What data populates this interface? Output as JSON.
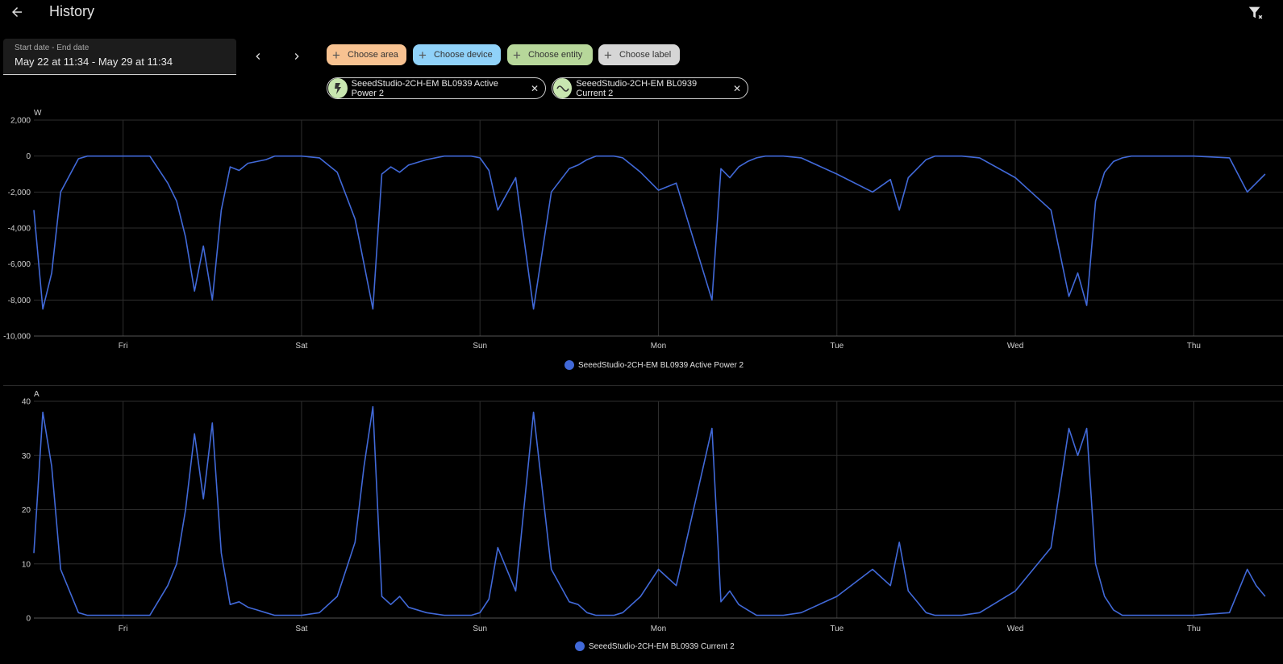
{
  "header": {
    "title": "History",
    "back_icon": "arrow-left-icon",
    "filter_icon": "filter-remove-icon"
  },
  "date_range": {
    "label": "Start date - End date",
    "value": "May 22 at 11:34 - May 29 at 11:34"
  },
  "filters": {
    "chips": [
      {
        "label": "Choose area",
        "color": "#f8c291"
      },
      {
        "label": "Choose device",
        "color": "#90d2f9"
      },
      {
        "label": "Choose entity",
        "color": "#b7d79a"
      },
      {
        "label": "Choose label",
        "color": "#d6d6d6"
      }
    ],
    "selected": [
      {
        "label": "SeeedStudio-2CH-EM BL0939 Active Power 2",
        "icon": "flash-icon"
      },
      {
        "label": "SeeedStudio-2CH-EM BL0939 Current 2",
        "icon": "current-ac-icon"
      }
    ]
  },
  "charts": [
    {
      "unit": "W",
      "y_ticks": [
        "2,000",
        "0",
        "-2,000",
        "-4,000",
        "-6,000",
        "-8,000",
        "-10,000"
      ],
      "x_ticks": [
        "Fri",
        "Sat",
        "Sun",
        "Mon",
        "Tue",
        "Wed",
        "Thu"
      ],
      "legend": "SeeedStudio-2CH-EM BL0939 Active Power 2"
    },
    {
      "unit": "A",
      "y_ticks": [
        "40",
        "30",
        "20",
        "10",
        "0"
      ],
      "x_ticks": [
        "Fri",
        "Sat",
        "Sun",
        "Mon",
        "Tue",
        "Wed",
        "Thu"
      ],
      "legend": "SeeedStudio-2CH-EM BL0939 Current 2"
    }
  ],
  "chart_data": [
    {
      "type": "line",
      "title": "",
      "ylabel": "W",
      "ylim": [
        -10000,
        2000
      ],
      "x_range": [
        "May 22 11:34",
        "May 29 11:34"
      ],
      "categories": [
        "Fri",
        "Sat",
        "Sun",
        "Mon",
        "Tue",
        "Wed",
        "Thu"
      ],
      "series": [
        {
          "name": "SeeedStudio-2CH-EM BL0939 Active Power 2",
          "color": "#4169d8",
          "x": [
            0.0,
            0.05,
            0.1,
            0.15,
            0.25,
            0.3,
            0.35,
            0.45,
            0.65,
            0.75,
            0.8,
            0.85,
            0.9,
            0.95,
            1.0,
            1.05,
            1.1,
            1.15,
            1.2,
            1.25,
            1.3,
            1.35,
            1.4,
            1.5,
            1.6,
            1.7,
            1.75,
            1.8,
            1.85,
            1.9,
            1.95,
            2.0,
            2.05,
            2.1,
            2.2,
            2.3,
            2.4,
            2.45,
            2.5,
            2.55,
            2.6,
            2.7,
            2.8,
            2.9,
            3.0,
            3.05,
            3.1,
            3.15,
            3.2,
            3.25,
            3.3,
            3.4,
            3.5,
            3.6,
            3.8,
            3.85,
            3.9,
            3.95,
            4.0,
            4.05,
            4.1,
            4.15,
            4.2,
            4.3,
            4.5,
            4.7,
            4.8,
            4.85,
            4.9,
            4.95,
            5.0,
            5.05,
            5.1,
            5.15,
            5.2,
            5.3,
            5.5,
            5.7,
            5.8,
            5.85,
            5.9,
            5.95,
            6.0,
            6.05,
            6.1,
            6.15,
            6.2,
            6.3,
            6.5,
            6.7,
            6.8,
            6.85,
            6.9
          ],
          "values": [
            -3000,
            -8500,
            -6500,
            -2000,
            -150,
            0,
            0,
            0,
            0,
            -1500,
            -2500,
            -4500,
            -7500,
            -5000,
            -8000,
            -3000,
            -600,
            -800,
            -400,
            -300,
            -200,
            0,
            0,
            0,
            -100,
            -900,
            -2200,
            -3500,
            -6000,
            -8500,
            -1000,
            -600,
            -900,
            -500,
            -200,
            0,
            0,
            0,
            -100,
            -800,
            -3000,
            -1200,
            -8500,
            -2000,
            -700,
            -500,
            -200,
            0,
            0,
            0,
            -100,
            -900,
            -1900,
            -1500,
            -8000,
            -700,
            -1200,
            -600,
            -300,
            -100,
            0,
            0,
            0,
            -100,
            -1000,
            -2000,
            -1300,
            -3000,
            -1200,
            -700,
            -200,
            0,
            0,
            0,
            0,
            -100,
            -1200,
            -3000,
            -7800,
            -6500,
            -8300,
            -2500,
            -900,
            -300,
            -100,
            0,
            0,
            0,
            0,
            -100,
            -2000,
            -1500,
            -1000
          ]
        }
      ]
    },
    {
      "type": "line",
      "title": "",
      "ylabel": "A",
      "ylim": [
        0,
        40
      ],
      "x_range": [
        "May 22 11:34",
        "May 29 11:34"
      ],
      "categories": [
        "Fri",
        "Sat",
        "Sun",
        "Mon",
        "Tue",
        "Wed",
        "Thu"
      ],
      "series": [
        {
          "name": "SeeedStudio-2CH-EM BL0939 Current 2",
          "color": "#4169d8",
          "x": [
            0.0,
            0.05,
            0.1,
            0.15,
            0.25,
            0.3,
            0.35,
            0.45,
            0.65,
            0.75,
            0.8,
            0.85,
            0.9,
            0.95,
            1.0,
            1.05,
            1.1,
            1.15,
            1.2,
            1.25,
            1.3,
            1.35,
            1.4,
            1.5,
            1.6,
            1.7,
            1.75,
            1.8,
            1.85,
            1.9,
            1.95,
            2.0,
            2.05,
            2.1,
            2.2,
            2.3,
            2.4,
            2.45,
            2.5,
            2.55,
            2.6,
            2.7,
            2.8,
            2.9,
            3.0,
            3.05,
            3.1,
            3.15,
            3.2,
            3.25,
            3.3,
            3.4,
            3.5,
            3.6,
            3.8,
            3.85,
            3.9,
            3.95,
            4.0,
            4.05,
            4.1,
            4.15,
            4.2,
            4.3,
            4.5,
            4.7,
            4.8,
            4.85,
            4.9,
            4.95,
            5.0,
            5.05,
            5.1,
            5.15,
            5.2,
            5.3,
            5.5,
            5.7,
            5.8,
            5.85,
            5.9,
            5.95,
            6.0,
            6.05,
            6.1,
            6.15,
            6.2,
            6.3,
            6.5,
            6.7,
            6.8,
            6.85,
            6.9
          ],
          "values": [
            12,
            38,
            28,
            9,
            1,
            0.5,
            0.5,
            0.5,
            0.5,
            6,
            10,
            20,
            34,
            22,
            36,
            12,
            2.5,
            3,
            2,
            1.5,
            1,
            0.5,
            0.5,
            0.5,
            1,
            4,
            9,
            14,
            28,
            39,
            4,
            2.5,
            4,
            2,
            1,
            0.5,
            0.5,
            0.5,
            1,
            3.5,
            13,
            5,
            38,
            9,
            3,
            2.5,
            1,
            0.5,
            0.5,
            0.5,
            1,
            4,
            9,
            6,
            35,
            3,
            5,
            2.5,
            1.5,
            0.5,
            0.5,
            0.5,
            0.5,
            1,
            4,
            9,
            6,
            14,
            5,
            3,
            1,
            0.5,
            0.5,
            0.5,
            0.5,
            1,
            5,
            13,
            35,
            30,
            35,
            10,
            4,
            1.5,
            0.5,
            0.5,
            0.5,
            0.5,
            0.5,
            1,
            9,
            6,
            4
          ]
        }
      ]
    }
  ]
}
